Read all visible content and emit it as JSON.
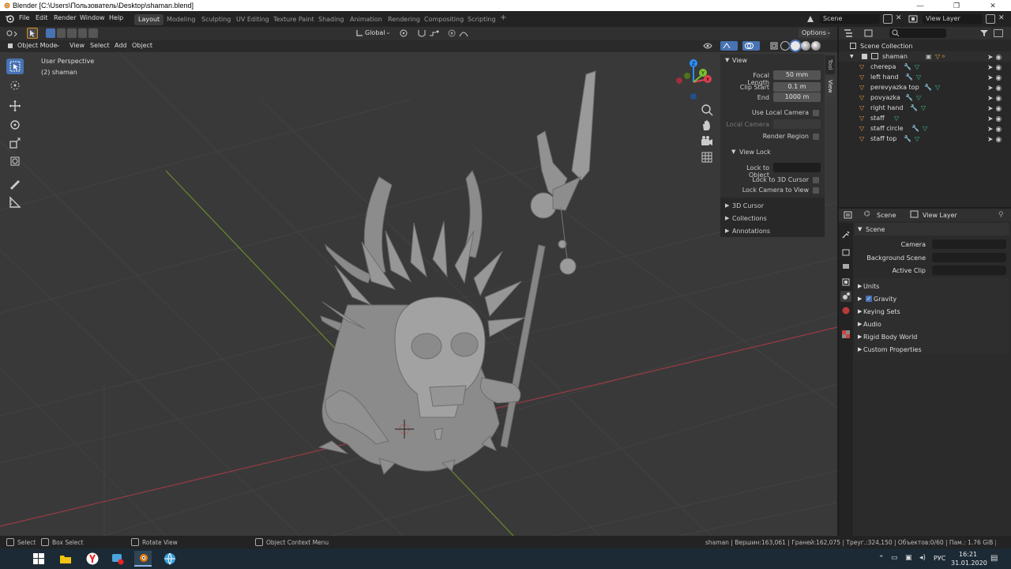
{
  "window": {
    "title": "Blender [C:\\Users\\Пользователь\\Desktop\\shaman.blend]"
  },
  "menu": [
    "File",
    "Edit",
    "Render",
    "Window",
    "Help"
  ],
  "workspaces": [
    "Layout",
    "Modeling",
    "Sculpting",
    "UV Editing",
    "Texture Paint",
    "Shading",
    "Animation",
    "Rendering",
    "Compositing",
    "Scripting"
  ],
  "active_workspace": "Layout",
  "scene_name": "Scene",
  "view_layer": "View Layer",
  "header": {
    "transform_orientation": "Global",
    "options_label": "Options",
    "mode": "Object Mode",
    "view": "View",
    "select": "Select",
    "add": "Add",
    "object": "Object"
  },
  "viewport": {
    "perspective_label": "User Perspective",
    "object_label": "(2) shaman",
    "gizmo_axes": {
      "x": "X",
      "y": "Y",
      "z": "Z"
    }
  },
  "npanel": {
    "tabs": [
      "Tool",
      "View"
    ],
    "view_header": "View",
    "focal_length_label": "Focal Length",
    "focal_length": "50 mm",
    "clip_start_label": "Clip Start",
    "clip_start": "0.1 m",
    "end_label": "End",
    "end": "1000 m",
    "use_local_camera": "Use Local Camera",
    "local_camera": "Local Camera",
    "render_region": "Render Region",
    "view_lock_header": "View Lock",
    "lock_to_object": "Lock to Object",
    "lock_to_3d_cursor": "Lock to 3D Cursor",
    "lock_camera_to_view": "Lock Camera to View",
    "cursor_3d": "3D Cursor",
    "collections": "Collections",
    "annotations": "Annotations"
  },
  "outliner": {
    "root": "Scene Collection",
    "collection": "shaman",
    "items": [
      "cherepa",
      "left hand",
      "perevyazka top",
      "povyazka",
      "right hand",
      "staff",
      "staff circle",
      "staff top"
    ]
  },
  "properties": {
    "scene_tab": "Scene",
    "view_layer_tab": "View Layer",
    "panel_header": "Scene",
    "camera_label": "Camera",
    "background_scene_label": "Background Scene",
    "active_clip_label": "Active Clip",
    "sections": [
      "Units",
      "Gravity",
      "Keying Sets",
      "Audio",
      "Rigid Body World",
      "Custom Properties"
    ]
  },
  "status": {
    "select": "Select",
    "box_select": "Box Select",
    "rotate_view": "Rotate View",
    "context_menu": "Object Context Menu",
    "stats": "shaman | Вершин:163,061 | Граней:162,075 | Треуг.:324,150 | Объектов:0/60 | Пам.: 1.76 GiB | v2.81.16"
  },
  "taskbar": {
    "lang": "РУС",
    "time": "16:21",
    "date": "31.01.2020"
  }
}
